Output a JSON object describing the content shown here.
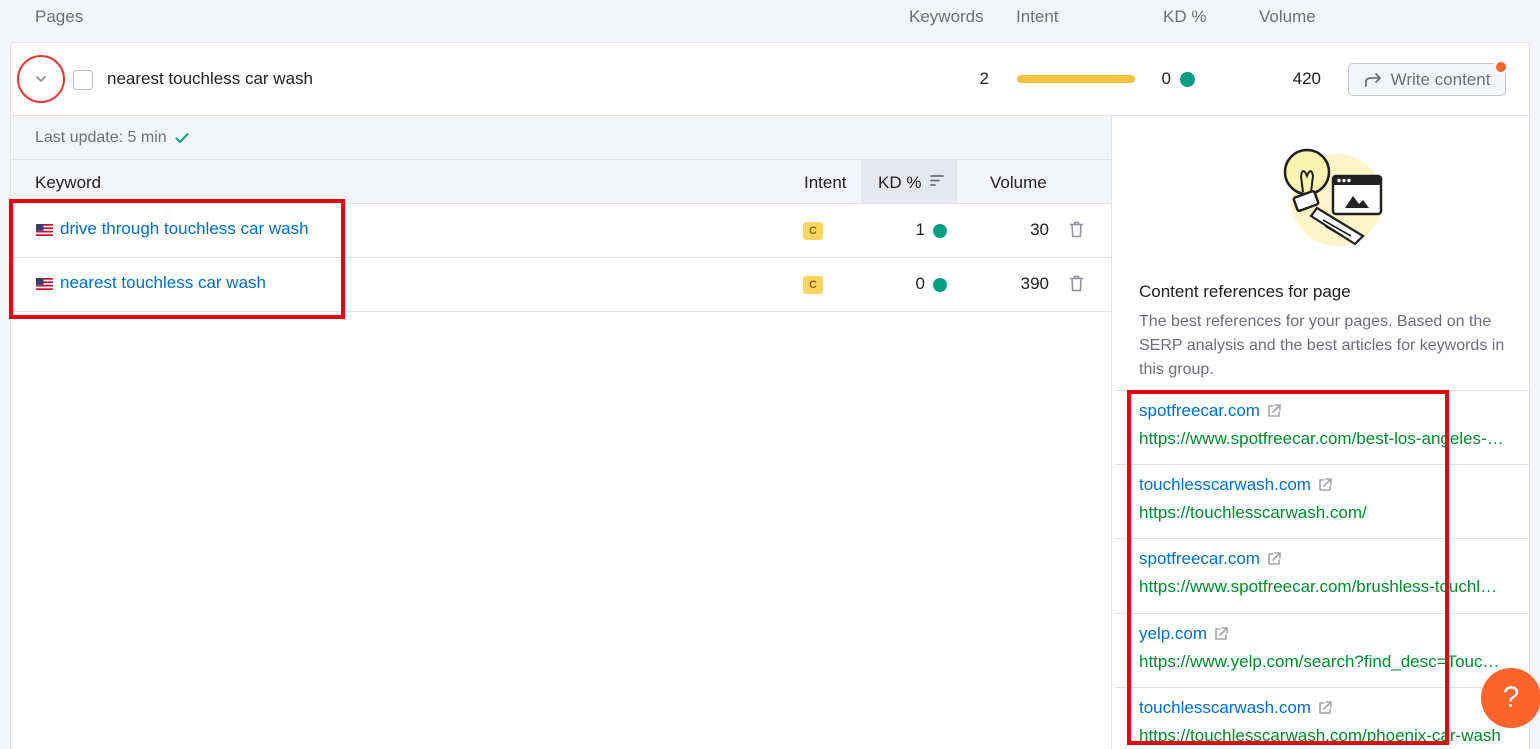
{
  "columns": {
    "pages": "Pages",
    "keywords": "Keywords",
    "intent": "Intent",
    "kd": "KD %",
    "volume": "Volume"
  },
  "page": {
    "title": "nearest touchless car wash",
    "keywords": "2",
    "intent_level": 1.0,
    "kd": "0",
    "volume": "420",
    "write_button": "Write content"
  },
  "last_update": "Last update: 5 min",
  "keyword_table": {
    "headers": {
      "keyword": "Keyword",
      "intent": "Intent",
      "kd": "KD %",
      "volume": "Volume"
    },
    "rows": [
      {
        "keyword": "drive through touchless car wash",
        "intent": "C",
        "kd": "1",
        "volume": "30"
      },
      {
        "keyword": "nearest touchless car wash",
        "intent": "C",
        "kd": "0",
        "volume": "390"
      }
    ]
  },
  "references": {
    "title": "Content references for page",
    "description": "The best references for your pages. Based on the SERP analysis and the best articles for keywords in this group.",
    "items": [
      {
        "domain": "spotfreecar.com",
        "url": "https://www.spotfreecar.com/best-los-angeles-touchless-car-wash"
      },
      {
        "domain": "touchlesscarwash.com",
        "url": "https://touchlesscarwash.com/"
      },
      {
        "domain": "spotfreecar.com",
        "url": "https://www.spotfreecar.com/brushless-touchless-car-wash"
      },
      {
        "domain": "yelp.com",
        "url": "https://www.yelp.com/search?find_desc=Touchless+Car+Wash"
      },
      {
        "domain": "touchlesscarwash.com",
        "url": "https://touchlesscarwash.com/phoenix-car-wash"
      }
    ]
  },
  "help_label": "?",
  "colors": {
    "intent_bar": "#f7c33b",
    "kd_dot": "#009f81",
    "link": "#006dca",
    "url": "#008a2e",
    "highlight": "#e8000b",
    "accent": "#ff642d"
  }
}
